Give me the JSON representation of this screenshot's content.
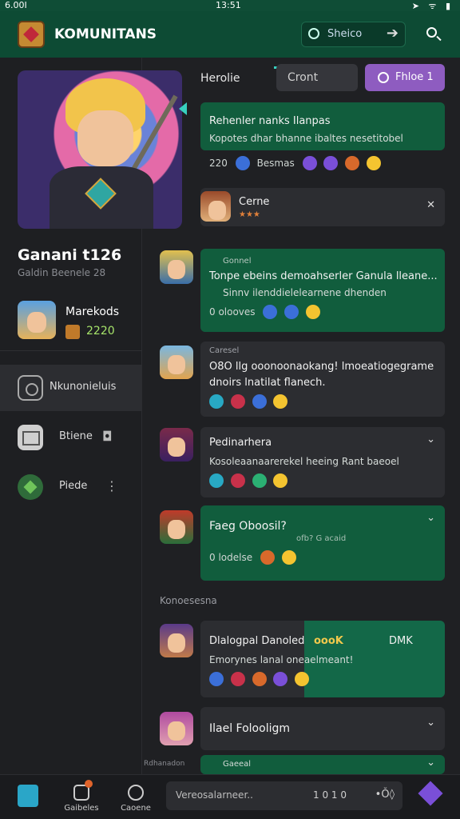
{
  "status": {
    "left": "6.00I",
    "time": "13:51",
    "right": "➤ ᯤ ▮"
  },
  "header": {
    "title": "KOMUNITANS",
    "search_text": "Sheico",
    "go_glyph": "➔"
  },
  "sidebar": {
    "user_name": "Ganani t126",
    "user_sub": "Galdin Beenele 28",
    "friend_name": "Marekods",
    "friend_score": "2220",
    "nav": [
      {
        "label": "Nkunonieluis"
      },
      {
        "label": "Btiene",
        "trail": "◘"
      },
      {
        "label": "Piede",
        "trail": "⋮"
      }
    ]
  },
  "main": {
    "heroes_label": "Herolie",
    "grey_btn": "Cront",
    "purple_btn": "Fhloe 1",
    "cards": [
      {
        "t1": "Rehenler nanks Ilanpas",
        "t2": "Kopotes dhar bhanne ibaltes nesetitobel"
      },
      {
        "count": "220",
        "label": "Besmas"
      },
      {
        "t1": "Cerne",
        "stars": "★★★"
      },
      {
        "t1": "Gonnel",
        "t2": "Tonpe ebeins demoahserler Ganula lleane...",
        "t3": "Sinnv ilenddielelearnene dhenden",
        "count": "0 olooves"
      },
      {
        "t1": "Caresel",
        "t2": "O8O llg ooonoonaokang! lmoeatiogegrame",
        "t3": "dnoirs lnatilat flanech."
      },
      {
        "t1": "Pedinarhera",
        "t2": "Kosoleaanaarerekel heeing Rant baeoel"
      },
      {
        "t1": "Faeg Oboosil?",
        "t2": "ofb? G   acaid",
        "count": "0 lodelse"
      },
      {
        "t1": "Dlalogpal Danoled",
        "t1b": "oooK",
        "right": "DMK",
        "t2": "Emorynes lanal oneaelmeant!"
      },
      {
        "t1": "Ilael Folooligm"
      },
      {
        "t1": "Gaeeal"
      }
    ],
    "section_label": "Konoesesna",
    "side_strip": "Rdhanadon"
  },
  "bottom": {
    "items": [
      {
        "label": "Gaibeles"
      },
      {
        "label": "Caoene"
      }
    ],
    "composer_placeholder": "Vereosalarneer..",
    "composer_count": "1 0  1 0",
    "composer_more": "•Ǒ◊"
  }
}
